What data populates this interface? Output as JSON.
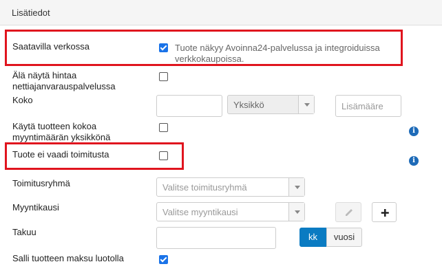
{
  "panel": {
    "title": "Lisätiedot"
  },
  "fields": {
    "available_online": {
      "label": "Saatavilla verkossa",
      "checked": true,
      "help": "Tuote näkyy Avoinna24-palvelussa ja integroiduissa verkkokaupoissa."
    },
    "hide_price": {
      "label": "Älä näytä hintaa nettiajanvarauspalvelussa",
      "checked": false
    },
    "size": {
      "label": "Koko",
      "value": "",
      "unit_select": "Yksikkö",
      "extra_placeholder": "Lisämääre"
    },
    "use_size_as_unit": {
      "label": "Käytä tuotteen kokoa myyntimäärän yksikkönä",
      "checked": false
    },
    "no_delivery": {
      "label": "Tuote ei vaadi toimitusta",
      "checked": false
    },
    "delivery_group": {
      "label": "Toimitusryhmä",
      "select": "Valitse toimitusryhmä"
    },
    "sales_period": {
      "label": "Myyntikausi",
      "select": "Valitse myyntikausi"
    },
    "warranty": {
      "label": "Takuu",
      "value": "",
      "unit_options": [
        "kk",
        "vuosi"
      ],
      "selected_unit": "kk"
    },
    "allow_credit": {
      "label": "Salli tuotteen maksu luotolla",
      "checked": true
    }
  },
  "icons": {
    "info": "info-icon",
    "edit": "pencil-icon",
    "add": "plus-icon"
  },
  "colors": {
    "highlight": "#e0141e",
    "accent": "#1a73e8",
    "toggle_active": "#0a7bc2",
    "info": "#1e6bb8"
  }
}
